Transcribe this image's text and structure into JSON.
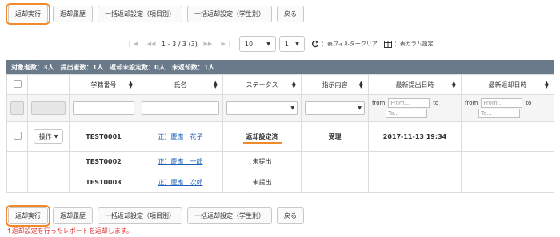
{
  "top_buttons": {
    "return_exec": "返却実行",
    "return_history": "返却履歴",
    "bulk_by_item": "一括返却設定（項目別）",
    "bulk_by_student": "一括返却設定（学生別）",
    "back": "戻る"
  },
  "pager": {
    "range": "1 - 3 / 3 (3)",
    "per_page": "10",
    "page": "1",
    "filter_clear": "：表フィルタークリア",
    "column_settings": "：表カラム設定"
  },
  "summary": "対象者数：3人　提出者数：1人　返却未設定数：0人　未返却数：1人",
  "columns": {
    "student_no": "学籍番号",
    "name": "氏名",
    "status": "ステータス",
    "instruction": "指示内容",
    "latest_submit": "最新提出日時",
    "latest_return": "最新返却日時"
  },
  "filters": {
    "from_label": "from",
    "to_label": "to",
    "from_placeholder": "From...",
    "to_placeholder": "To..."
  },
  "rows": [
    {
      "op": "操作",
      "student_no": "TEST0001",
      "name": "正）慶應　花子",
      "status": "返却設定済",
      "instruction": "受理",
      "submitted": "2017-11-13 19:34",
      "returned": ""
    },
    {
      "op": "",
      "student_no": "TEST0002",
      "name": "正）慶應　一郎",
      "status": "未提出",
      "instruction": "",
      "submitted": "",
      "returned": ""
    },
    {
      "op": "",
      "student_no": "TEST0003",
      "name": "正）慶應　次郎",
      "status": "未提出",
      "instruction": "",
      "submitted": "",
      "returned": ""
    }
  ],
  "bottom_buttons": {
    "return_exec": "返却実行",
    "return_history": "返却履歴",
    "bulk_by_item": "一括返却設定（項目別）",
    "bulk_by_student": "一括返却設定（学生別）",
    "back": "戻る"
  },
  "note": "↑返却設定を行ったレポートを返却します。",
  "colors": {
    "highlight": "#f08a2a",
    "summary_bg": "#6a7a8a",
    "link": "#1a5fb4",
    "note": "#dd3333"
  }
}
